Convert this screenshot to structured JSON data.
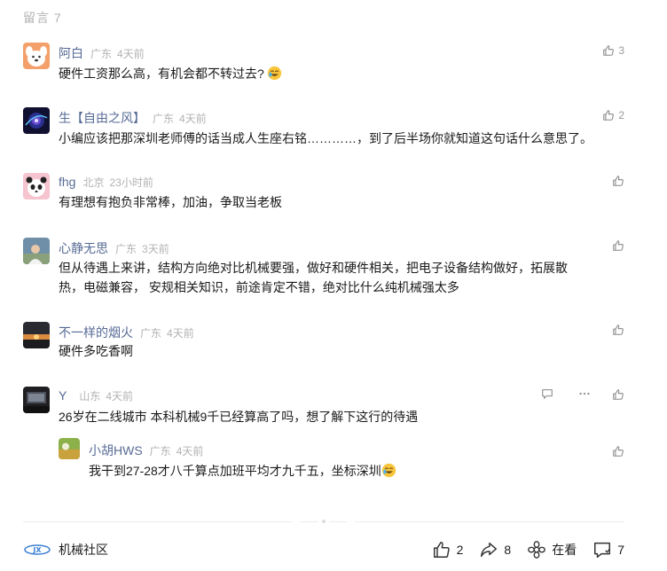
{
  "header": {
    "label": "留言 7"
  },
  "comments": [
    {
      "name": "阿白",
      "location": "广东",
      "time": "4天前",
      "text_lines": [
        "硬件工资那么高，有机会都不转过去?"
      ],
      "likes": "3",
      "has_emoji": true,
      "avatar_icon": "dog-avatar"
    },
    {
      "name": "生【自由之风】",
      "location": "广东",
      "time": "4天前",
      "text_lines": [
        "小编应该把那深圳老师傅的话当成人生座右铭…………，到了后半场你就知道这句话什么意思了。"
      ],
      "likes": "2",
      "avatar_icon": "galaxy-avatar"
    },
    {
      "name": "fhg",
      "location": "北京",
      "time": "23小时前",
      "text_lines": [
        "有理想有抱负非常棒，加油，争取当老板"
      ],
      "likes": "",
      "avatar_icon": "panda-avatar"
    },
    {
      "name": "心静无思",
      "location": "广东",
      "time": "3天前",
      "text_lines": [
        "但从待遇上来讲，结构方向绝对比机械要强，做好和硬件相关，把电子设备结构做好，拓展散",
        "热，电磁兼容，  安规相关知识，前途肯定不错，绝对比什么纯机械强太多"
      ],
      "likes": "",
      "avatar_icon": "person-avatar"
    },
    {
      "name": "不一样的烟火",
      "location": "广东",
      "time": "4天前",
      "text_lines": [
        "硬件多吃香啊"
      ],
      "likes": "",
      "avatar_icon": "sunset-avatar"
    },
    {
      "name": "Y",
      "location": "山东",
      "time": "4天前",
      "text_lines": [
        "26岁在二线城市 本科机械9千已经算高了吗，想了解下这行的待遇"
      ],
      "likes": "",
      "avatar_icon": "window-avatar"
    }
  ],
  "reply": {
    "name": "小胡HWS",
    "location": "广东",
    "time": "4天前",
    "text": "我干到27-28才八千算点加班平均才九千五，坐标深圳",
    "avatar_icon": "landscape-avatar"
  },
  "bottom": {
    "brand": "机械社区",
    "likes": "2",
    "shares": "8",
    "watching": "在看",
    "comments": "7"
  }
}
